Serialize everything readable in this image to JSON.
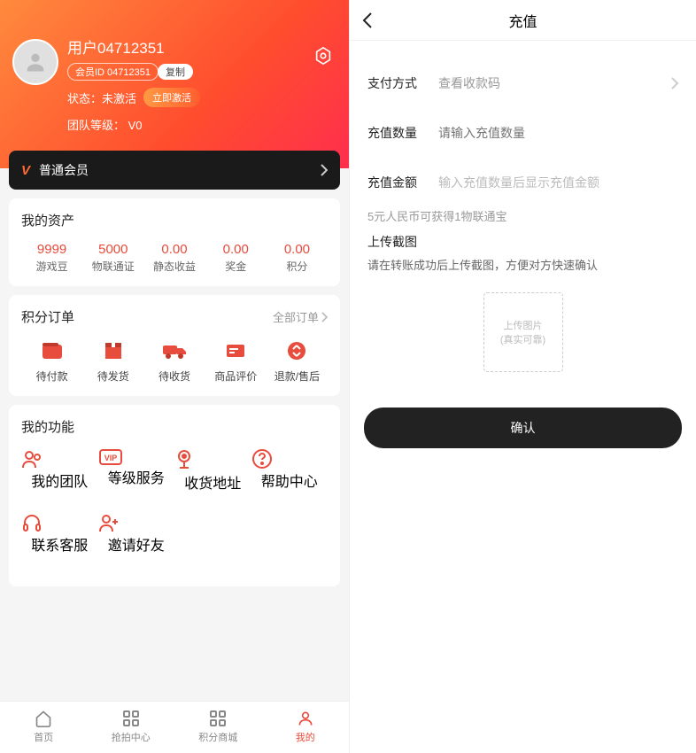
{
  "left": {
    "username": "用户04712351",
    "member_id_label": "会员ID 04712351",
    "copy": "复制",
    "status_label": "状态：",
    "status_value": "未激活",
    "activate": "立即激活",
    "team_tier_label": "团队等级：",
    "team_tier_value": "V0",
    "member_bar": "普通会员",
    "assets_title": "我的资产",
    "assets": [
      {
        "val": "9999",
        "lbl": "游戏豆"
      },
      {
        "val": "5000",
        "lbl": "物联通证"
      },
      {
        "val": "0.00",
        "lbl": "静态收益"
      },
      {
        "val": "0.00",
        "lbl": "奖金"
      },
      {
        "val": "0.00",
        "lbl": "积分"
      }
    ],
    "orders_title": "积分订单",
    "all_orders": "全部订单",
    "orders": [
      {
        "lbl": "待付款"
      },
      {
        "lbl": "待发货"
      },
      {
        "lbl": "待收货"
      },
      {
        "lbl": "商品评价"
      },
      {
        "lbl": "退款/售后"
      }
    ],
    "func_title": "我的功能",
    "funcs": [
      {
        "lbl": "我的团队"
      },
      {
        "lbl": "等级服务"
      },
      {
        "lbl": "收货地址"
      },
      {
        "lbl": "帮助中心"
      },
      {
        "lbl": "联系客服"
      },
      {
        "lbl": "邀请好友"
      }
    ],
    "tabs": [
      {
        "lbl": "首页"
      },
      {
        "lbl": "抢拍中心"
      },
      {
        "lbl": "积分商城"
      },
      {
        "lbl": "我的"
      }
    ]
  },
  "right": {
    "title": "充值",
    "pay_method_label": "支付方式",
    "pay_method_value": "查看收款码",
    "qty_label": "充值数量",
    "qty_placeholder": "请输入充值数量",
    "amt_label": "充值金额",
    "amt_hint": "输入充值数量后显示充值金额",
    "rate_hint": "5元人民币可获得1物联通宝",
    "upload_title": "上传截图",
    "upload_sub": "请在转账成功后上传截图，方便对方快速确认",
    "upload_box1": "上传图片",
    "upload_box2": "(真实可靠)",
    "confirm": "确认"
  }
}
